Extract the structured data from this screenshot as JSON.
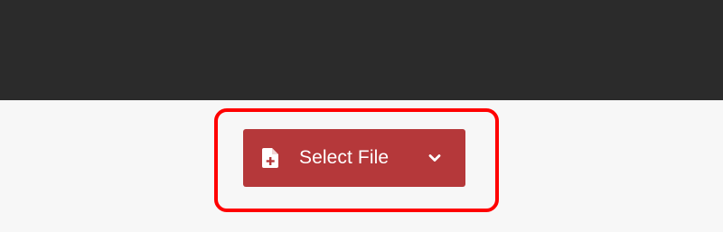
{
  "upload": {
    "button_label": "Select File",
    "icons": {
      "file": "file-plus-icon",
      "dropdown": "chevron-down-icon"
    }
  },
  "colors": {
    "header_background": "#2b2b2b",
    "page_background": "#f7f7f7",
    "button_background": "#b5383a",
    "highlight_border": "#ff0000"
  }
}
